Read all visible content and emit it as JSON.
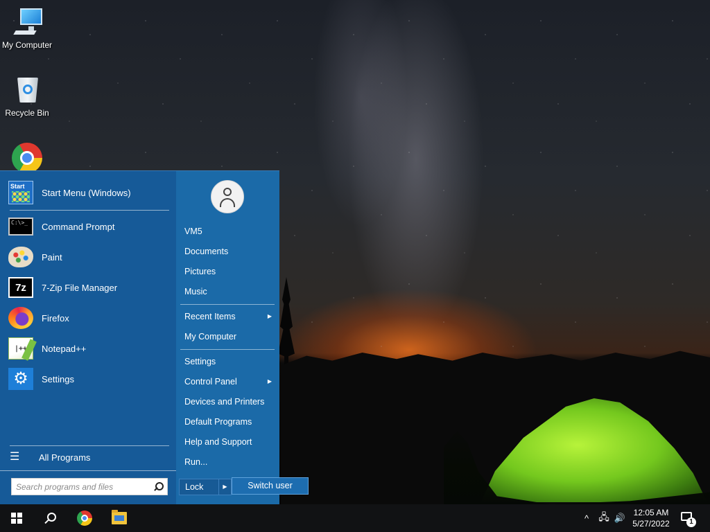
{
  "desktop": {
    "icons": [
      {
        "label": "My Computer",
        "icon": "computer-icon"
      },
      {
        "label": "Recycle Bin",
        "icon": "recycle-bin-icon"
      },
      {
        "label": "",
        "icon": "chrome-icon"
      }
    ]
  },
  "start_menu": {
    "pinned": [
      {
        "label": "Start Menu (Windows)",
        "icon": "start-menu-icon",
        "icon_text": "Start"
      },
      {
        "label": "Command Prompt",
        "icon": "command-prompt-icon",
        "icon_text": "C:\\>_"
      },
      {
        "label": "Paint",
        "icon": "paint-icon"
      },
      {
        "label": "7-Zip File Manager",
        "icon": "7zip-icon",
        "icon_text": "7z"
      },
      {
        "label": "Firefox",
        "icon": "firefox-icon"
      },
      {
        "label": "Notepad++",
        "icon": "notepadpp-icon",
        "icon_text": "|++"
      },
      {
        "label": "Settings",
        "icon": "settings-gear-icon",
        "icon_text": "⚙"
      }
    ],
    "all_programs": "All Programs",
    "search_placeholder": "Search programs and files",
    "right_items": [
      {
        "label": "VM5"
      },
      {
        "label": "Documents"
      },
      {
        "label": "Pictures"
      },
      {
        "label": "Music"
      },
      {
        "label": "Recent Items",
        "arrow": "▶"
      },
      {
        "label": "My Computer"
      },
      {
        "label": "Settings"
      },
      {
        "label": "Control Panel",
        "arrow": "▶"
      },
      {
        "label": "Devices and Printers"
      },
      {
        "label": "Default Programs"
      },
      {
        "label": "Help and Support"
      },
      {
        "label": "Run..."
      }
    ],
    "lock_label": "Lock",
    "lock_arrow": "▶",
    "switch_user_label": "Switch user"
  },
  "taskbar": {
    "pinned": [
      "start-button",
      "search-button",
      "chrome",
      "file-explorer"
    ],
    "tray_chevron": "^",
    "network_icon": "🖧",
    "volume_icon": "🔊",
    "clock": {
      "time": "12:05 AM",
      "date": "5/27/2022"
    },
    "notification_count": "1"
  },
  "colors": {
    "start_menu_left": "#165a98",
    "start_menu_right": "#1b6aa8",
    "taskbar": "#111214",
    "switch_user_highlight": "#1d6db0"
  }
}
